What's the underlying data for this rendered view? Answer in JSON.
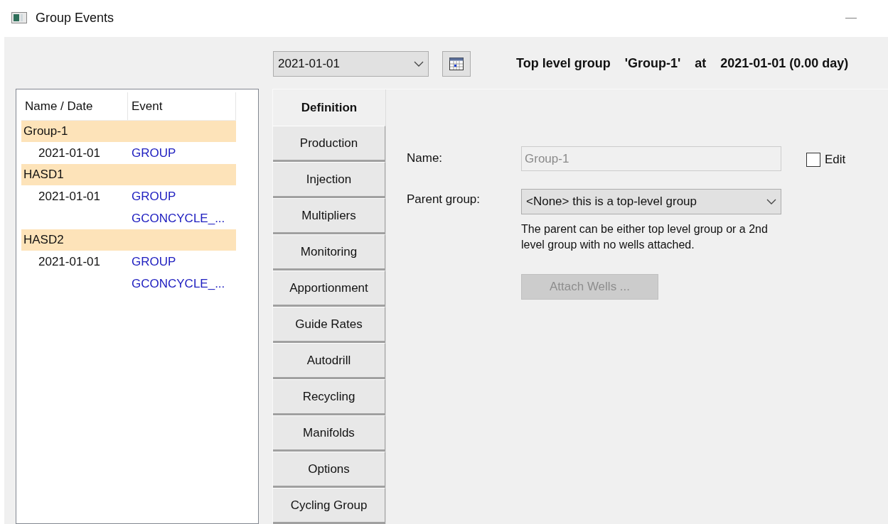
{
  "window": {
    "title": "Group Events",
    "minimize": "—"
  },
  "toolbar": {
    "date": "2021-01-01",
    "summary": [
      "Top level group",
      "'Group-1'",
      "at",
      "2021-01-01 (0.00 day)"
    ]
  },
  "event_list": {
    "columns": [
      "Name / Date",
      "Event"
    ],
    "groups": [
      {
        "name": "Group-1",
        "entries": [
          {
            "date": "2021-01-01",
            "events": [
              "GROUP"
            ]
          }
        ]
      },
      {
        "name": "HASD1",
        "entries": [
          {
            "date": "2021-01-01",
            "events": [
              "GROUP",
              "GCONCYCLE_..."
            ]
          }
        ]
      },
      {
        "name": "HASD2",
        "entries": [
          {
            "date": "2021-01-01",
            "events": [
              "GROUP",
              "GCONCYCLE_..."
            ]
          }
        ]
      }
    ]
  },
  "tabs": [
    {
      "label": "Definition",
      "selected": true
    },
    {
      "label": "Production",
      "selected": false
    },
    {
      "label": "Injection",
      "selected": false
    },
    {
      "label": "Multipliers",
      "selected": false
    },
    {
      "label": "Monitoring",
      "selected": false
    },
    {
      "label": "Apportionment",
      "selected": false
    },
    {
      "label": "Guide Rates",
      "selected": false
    },
    {
      "label": "Autodrill",
      "selected": false
    },
    {
      "label": "Recycling",
      "selected": false
    },
    {
      "label": "Manifolds",
      "selected": false
    },
    {
      "label": "Options",
      "selected": false
    },
    {
      "label": "Cycling Group",
      "selected": false
    }
  ],
  "definition": {
    "name_label": "Name:",
    "name_value": "Group-1",
    "name_disabled": true,
    "edit": {
      "label": "Edit",
      "checked": false
    },
    "parent_label": "Parent group:",
    "parent_value": "<None> this is a top-level group",
    "note": "The parent can be either top level group or a 2nd level group with no wells attached.",
    "attach_button": {
      "label": "Attach Wells ...",
      "disabled": true
    }
  }
}
